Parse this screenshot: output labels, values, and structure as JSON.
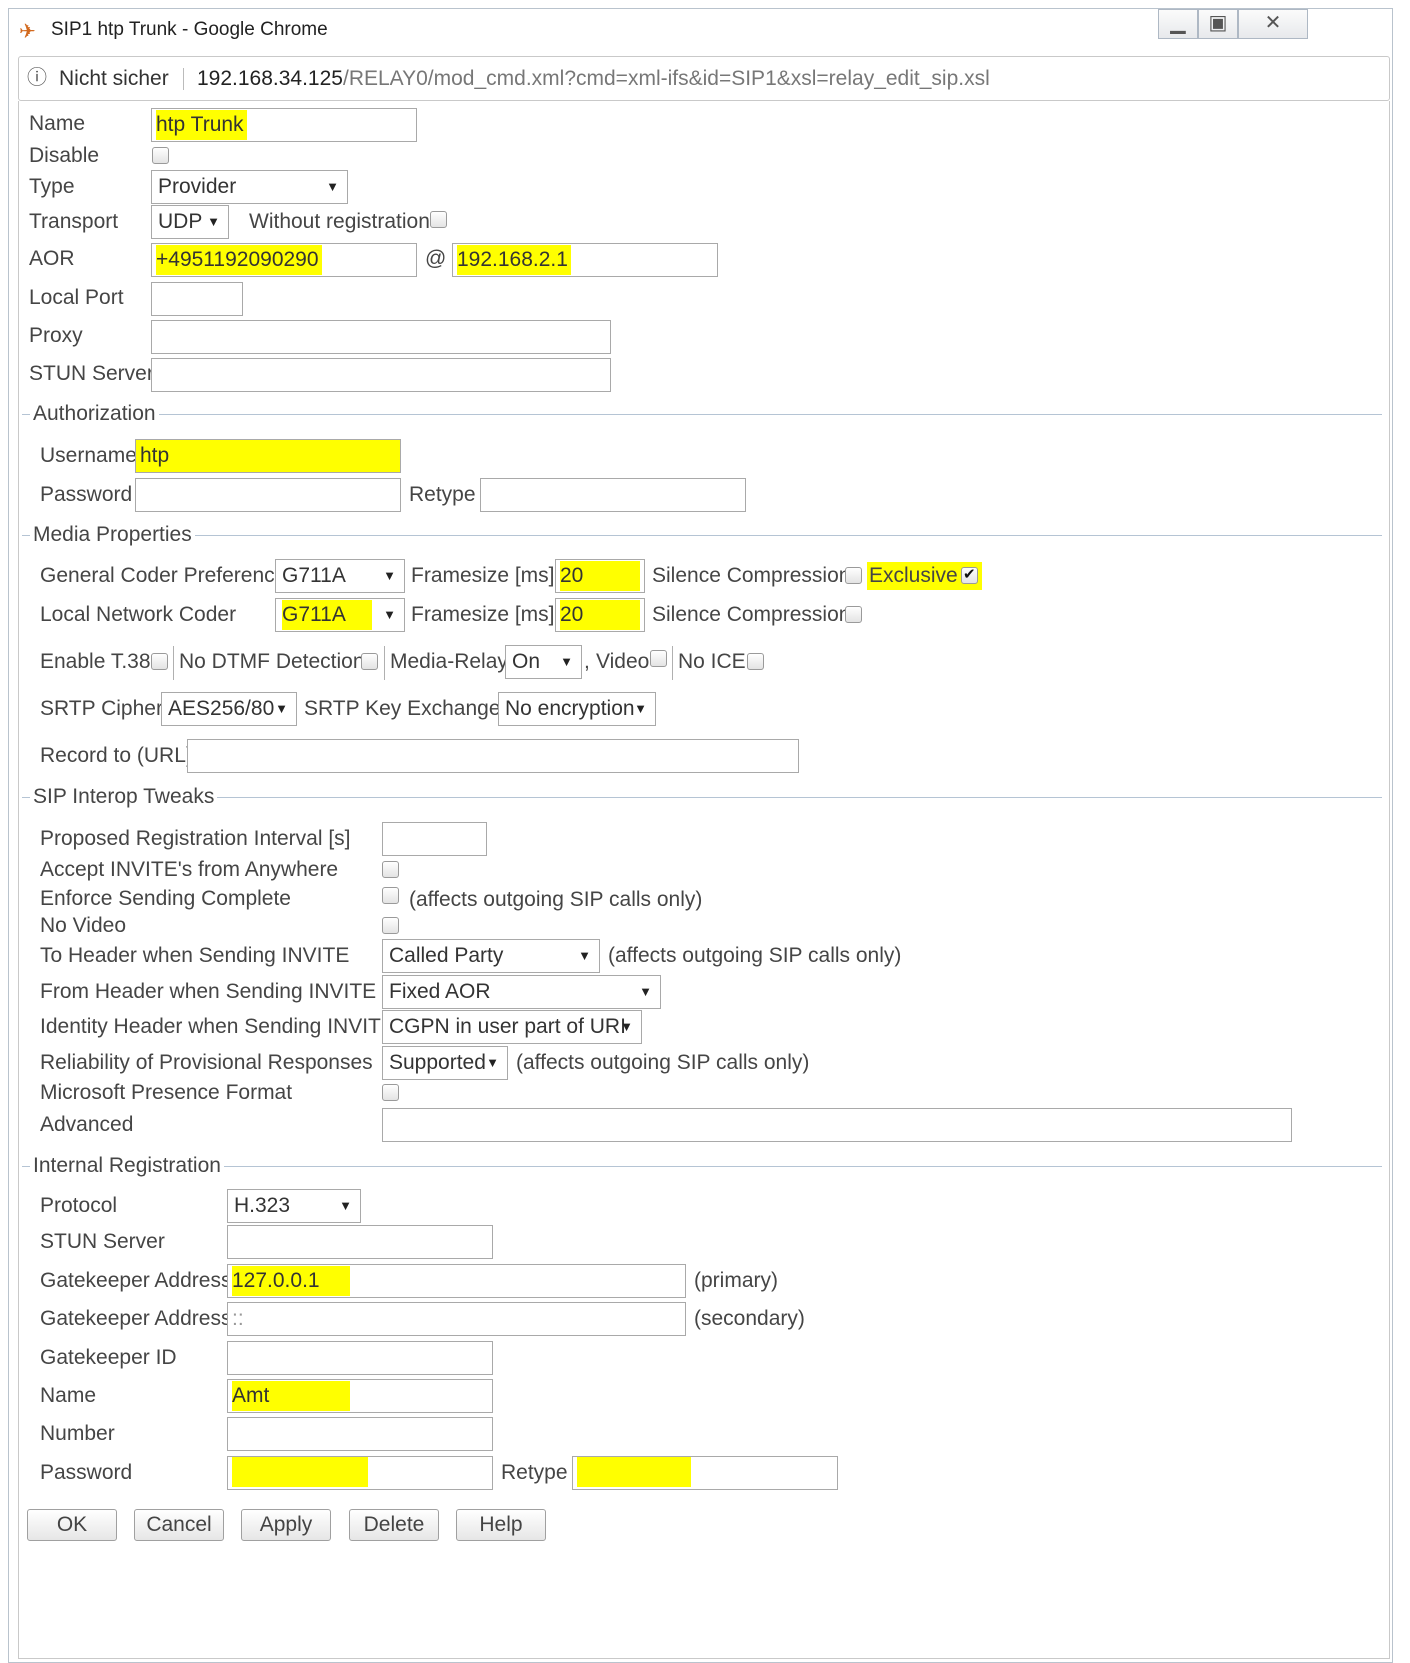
{
  "window": {
    "title": "SIP1 htp Trunk - Google Chrome",
    "controls": [
      "minimize",
      "maximize",
      "close"
    ]
  },
  "address_bar": {
    "security": "Nicht sicher",
    "host": "192.168.34.125",
    "path": "/RELAY0/mod_cmd.xml?cmd=xml-ifs&id=SIP1&xsl=relay_edit_sip.xsl"
  },
  "general": {
    "name_label": "Name",
    "name_value": "htp Trunk",
    "disable_label": "Disable",
    "type_label": "Type",
    "type_value": "Provider",
    "transport_label": "Transport",
    "transport_value": "UDP",
    "without_registration_label": "Without registration",
    "aor_label": "AOR",
    "aor_user": "+4951192090290",
    "at_sign": "@",
    "aor_host": "192.168.2.1",
    "local_port_label": "Local Port",
    "local_port_value": "",
    "proxy_label": "Proxy",
    "proxy_value": "",
    "stun_label": "STUN Server",
    "stun_value": ""
  },
  "authorization": {
    "legend": "Authorization",
    "username_label": "Username",
    "username_value": "htp",
    "password_label": "Password",
    "retype_label": "Retype"
  },
  "media": {
    "legend": "Media Properties",
    "gen_coder_label": "General Coder Preference",
    "gen_coder_value": "G711A",
    "framesize_label": "Framesize [ms]",
    "gen_framesize": "20",
    "silence_label": "Silence Compression",
    "exclusive_label": "Exclusive",
    "local_coder_label": "Local Network Coder",
    "local_coder_value": "G711A",
    "local_framesize": "20",
    "t38_label": "Enable T.38",
    "no_dtmf_label": "No DTMF Detection",
    "media_relay_label": "Media-Relay",
    "media_relay_value": "On",
    "comma": ",",
    "video_label": "Video",
    "no_ice_label": "No ICE",
    "srtp_cipher_label": "SRTP Cipher",
    "srtp_cipher_value": "AES256/80",
    "srtp_key_label": "SRTP Key Exchange",
    "srtp_key_value": "No encryption",
    "record_label": "Record to (URL)",
    "record_value": ""
  },
  "interop": {
    "legend": "SIP Interop Tweaks",
    "reg_interval_label": "Proposed Registration Interval [s]",
    "accept_invite_label": "Accept INVITE's from Anywhere",
    "enforce_label": "Enforce Sending Complete",
    "affects_note": "(affects outgoing SIP calls only)",
    "no_video_label": "No Video",
    "to_header_label": "To Header when Sending INVITE",
    "to_header_value": "Called Party",
    "from_header_label": "From Header when Sending INVITE",
    "from_header_value": "Fixed AOR",
    "identity_label": "Identity Header when Sending INVITE",
    "identity_value": "CGPN in user part of URI",
    "reliability_label": "Reliability of Provisional Responses",
    "reliability_value": "Supported",
    "ms_presence_label": "Microsoft Presence Format",
    "advanced_label": "Advanced"
  },
  "internal_reg": {
    "legend": "Internal Registration",
    "protocol_label": "Protocol",
    "protocol_value": "H.323",
    "stun_label": "STUN Server",
    "gk_addr_label": "Gatekeeper Address",
    "gk_primary_value": "127.0.0.1",
    "primary_note": "(primary)",
    "gk_secondary_value": "::",
    "secondary_note": "(secondary)",
    "gk_id_label": "Gatekeeper ID",
    "name_label": "Name",
    "name_value": "Amt",
    "number_label": "Number",
    "password_label": "Password",
    "retype_label": "Retype"
  },
  "buttons": {
    "ok": "OK",
    "cancel": "Cancel",
    "apply": "Apply",
    "delete": "Delete",
    "help": "Help"
  },
  "colors": {
    "highlight": "#ffff00",
    "legend_line": "#b5c4d4"
  }
}
